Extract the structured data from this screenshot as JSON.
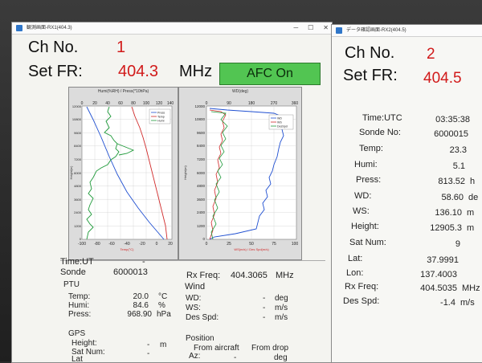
{
  "window1": {
    "title": "観測画面-RX1(404.3)",
    "ch_label": "Ch No.",
    "ch_value": "1",
    "fr_label": "Set FR:",
    "fr_value": "404.3",
    "fr_unit": "MHz",
    "afc_label": "AFC On",
    "plot1": {
      "title": "Humi(%RH) / Press(*10hPa)",
      "top_ticks": [
        "0",
        "20",
        "40",
        "60",
        "80",
        "100",
        "120",
        "140"
      ],
      "left_ticks": [
        "12000",
        "10800",
        "9600",
        "8400",
        "7200",
        "6000",
        "4800",
        "3600",
        "2400",
        "1200",
        "0"
      ],
      "bottom_ticks": [
        "-100",
        "-80",
        "-60",
        "-40",
        "-20",
        "0",
        "20"
      ],
      "bottom_label": "Temp(°C)",
      "left_label": "Height(m)",
      "legend": [
        "Press",
        "Temp",
        "Humi"
      ]
    },
    "plot2": {
      "title": "WD(deg)",
      "top_ticks": [
        "0",
        "90",
        "180",
        "270",
        "360"
      ],
      "left_ticks": [
        "12000",
        "10800",
        "9600",
        "8400",
        "7200",
        "6000",
        "4800",
        "3600",
        "2400",
        "1200",
        "0"
      ],
      "bottom_ticks": [
        "0",
        "25",
        "50",
        "75",
        "100"
      ],
      "bottom_label": "WS(m/s) / Des Spd(m/s)",
      "left_label": "Height(m)",
      "legend": [
        "WD",
        "WS",
        "DesSpd"
      ]
    },
    "time_label": "Time:UT",
    "time_value": "-",
    "sonde_label": "Sonde",
    "sonde_value": "6000013",
    "rxfreq_label": "Rx Freq:",
    "rxfreq_value": "404.3065",
    "rxfreq_unit": "MHz",
    "ptu_label": "PTU",
    "temp_label": "Temp:",
    "temp_value": "20.0",
    "temp_unit": "°C",
    "humi_label": "Humi:",
    "humi_value": "84.6",
    "humi_unit": "%",
    "press_label": "Press:",
    "press_value": "968.90",
    "press_unit": "hPa",
    "wind_label": "Wind",
    "wd_label": "WD:",
    "wd_value": "-",
    "wd_unit": "deg",
    "ws_label": "WS:",
    "ws_value": "-",
    "ws_unit": "m/s",
    "desspd_label": "Des Spd:",
    "desspd_value": "-",
    "desspd_unit": "m/s",
    "gps_label": "GPS",
    "height_label": "Height:",
    "height_value": "-",
    "height_unit": "m",
    "satnum_label": "Sat Num:",
    "satnum_value": "-",
    "lat_label": "Lat",
    "position_label": "Position",
    "from_aircraft": "From aircraft",
    "from_drop": "From drop",
    "az_label": "Az:",
    "az_value": "-",
    "az_unit": "deg"
  },
  "window2": {
    "title": "データ確認画面-RX2(404.5)",
    "ch_label": "Ch No.",
    "ch_value": "2",
    "fr_label": "Set FR:",
    "fr_value": "404.5",
    "rows": [
      {
        "label": "Time:UTC",
        "value": "03:35:38",
        "unit": ""
      },
      {
        "label": "Sonde No:",
        "value": "6000015",
        "unit": ""
      },
      {
        "label": "Temp:",
        "value": "23.3",
        "unit": ""
      },
      {
        "label": "Humi:",
        "value": "5.1",
        "unit": ""
      },
      {
        "label": "Press:",
        "value": "813.52",
        "unit": "h"
      },
      {
        "label": "WD:",
        "value": "58.60",
        "unit": "de"
      },
      {
        "label": "WS:",
        "value": "136.10",
        "unit": "m"
      },
      {
        "label": "Height:",
        "value": "12905.3",
        "unit": "m"
      },
      {
        "label": "Sat Num:",
        "value": "9",
        "unit": ""
      },
      {
        "label": "Lat:",
        "value": "37.9991",
        "unit": ""
      },
      {
        "label": "Lon:",
        "value": "137.4003",
        "unit": ""
      },
      {
        "label": "Rx Freq:",
        "value": "404.5035",
        "unit": "MHz"
      },
      {
        "label": "Des Spd:",
        "value": "-1.4",
        "unit": "m/s"
      }
    ]
  },
  "colors": {
    "afc_green": "#52c552",
    "value_red": "#d11a1a",
    "press_line": "#1f4fd1",
    "temp_line": "#d12a2a",
    "humi_line": "#1f9a3a"
  }
}
